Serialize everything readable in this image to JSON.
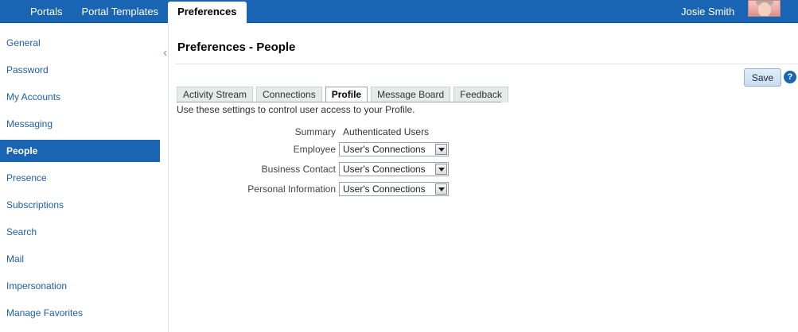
{
  "topnav": {
    "tabs": [
      {
        "label": "Portals"
      },
      {
        "label": "Portal Templates"
      },
      {
        "label": "Preferences",
        "active": true
      }
    ],
    "user_name": "Josie Smith"
  },
  "sidebar": {
    "items": [
      {
        "label": "General"
      },
      {
        "label": "Password"
      },
      {
        "label": "My Accounts"
      },
      {
        "label": "Messaging"
      },
      {
        "label": "People",
        "selected": true
      },
      {
        "label": "Presence"
      },
      {
        "label": "Subscriptions"
      },
      {
        "label": "Search"
      },
      {
        "label": "Mail"
      },
      {
        "label": "Impersonation"
      },
      {
        "label": "Manage Favorites"
      }
    ]
  },
  "main": {
    "title": "Preferences - People",
    "save_label": "Save",
    "help_label": "?",
    "tabs": [
      {
        "label": "Activity Stream"
      },
      {
        "label": "Connections"
      },
      {
        "label": "Profile",
        "active": true
      },
      {
        "label": "Message Board"
      },
      {
        "label": "Feedback"
      }
    ],
    "intro": "Use these settings to control user access to your Profile.",
    "form": {
      "summary_label": "Summary",
      "summary_value": "Authenticated Users",
      "employee_label": "Employee",
      "employee_value": "User's Connections",
      "business_label": "Business Contact",
      "business_value": "User's Connections",
      "personal_label": "Personal Information",
      "personal_value": "User's Connections"
    }
  },
  "colors": {
    "brand_blue": "#1a64b4",
    "link_blue": "#1f5fa6",
    "tab_inactive": "#e4ebe9"
  },
  "icons": {
    "collapse": "chevron-left-icon",
    "help": "help-icon",
    "dropdown": "chevron-down-icon"
  }
}
